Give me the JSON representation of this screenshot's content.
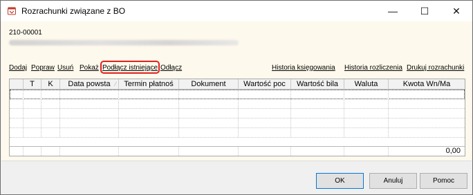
{
  "window": {
    "title": "Rozrachunki związane z BO",
    "minimize": "—",
    "maximize": "☐",
    "close": "✕"
  },
  "header": {
    "account_code": "210-00001"
  },
  "toolbar": {
    "add": "Dodaj",
    "edit": "Popraw",
    "delete": "Usuń",
    "show": "Pokaż",
    "attach_existing": "Podłącz istniejące",
    "detach": "Odłącz",
    "booking_history": "Historia księgowania",
    "settlement_history": "Historia rozliczenia",
    "print_settlements": "Drukuj rozrachunki"
  },
  "grid": {
    "columns": [
      "",
      "T",
      "K",
      "Data powsta",
      "Termin płatnoś",
      "Dokument",
      "Wartość poc",
      "Wartość bila",
      "Waluta",
      "Kwota Wn/Ma"
    ],
    "sort_indicator": "⁄",
    "total": "0,00"
  },
  "buttons": {
    "ok": "OK",
    "cancel": "Anuluj",
    "help": "Pomoc"
  }
}
